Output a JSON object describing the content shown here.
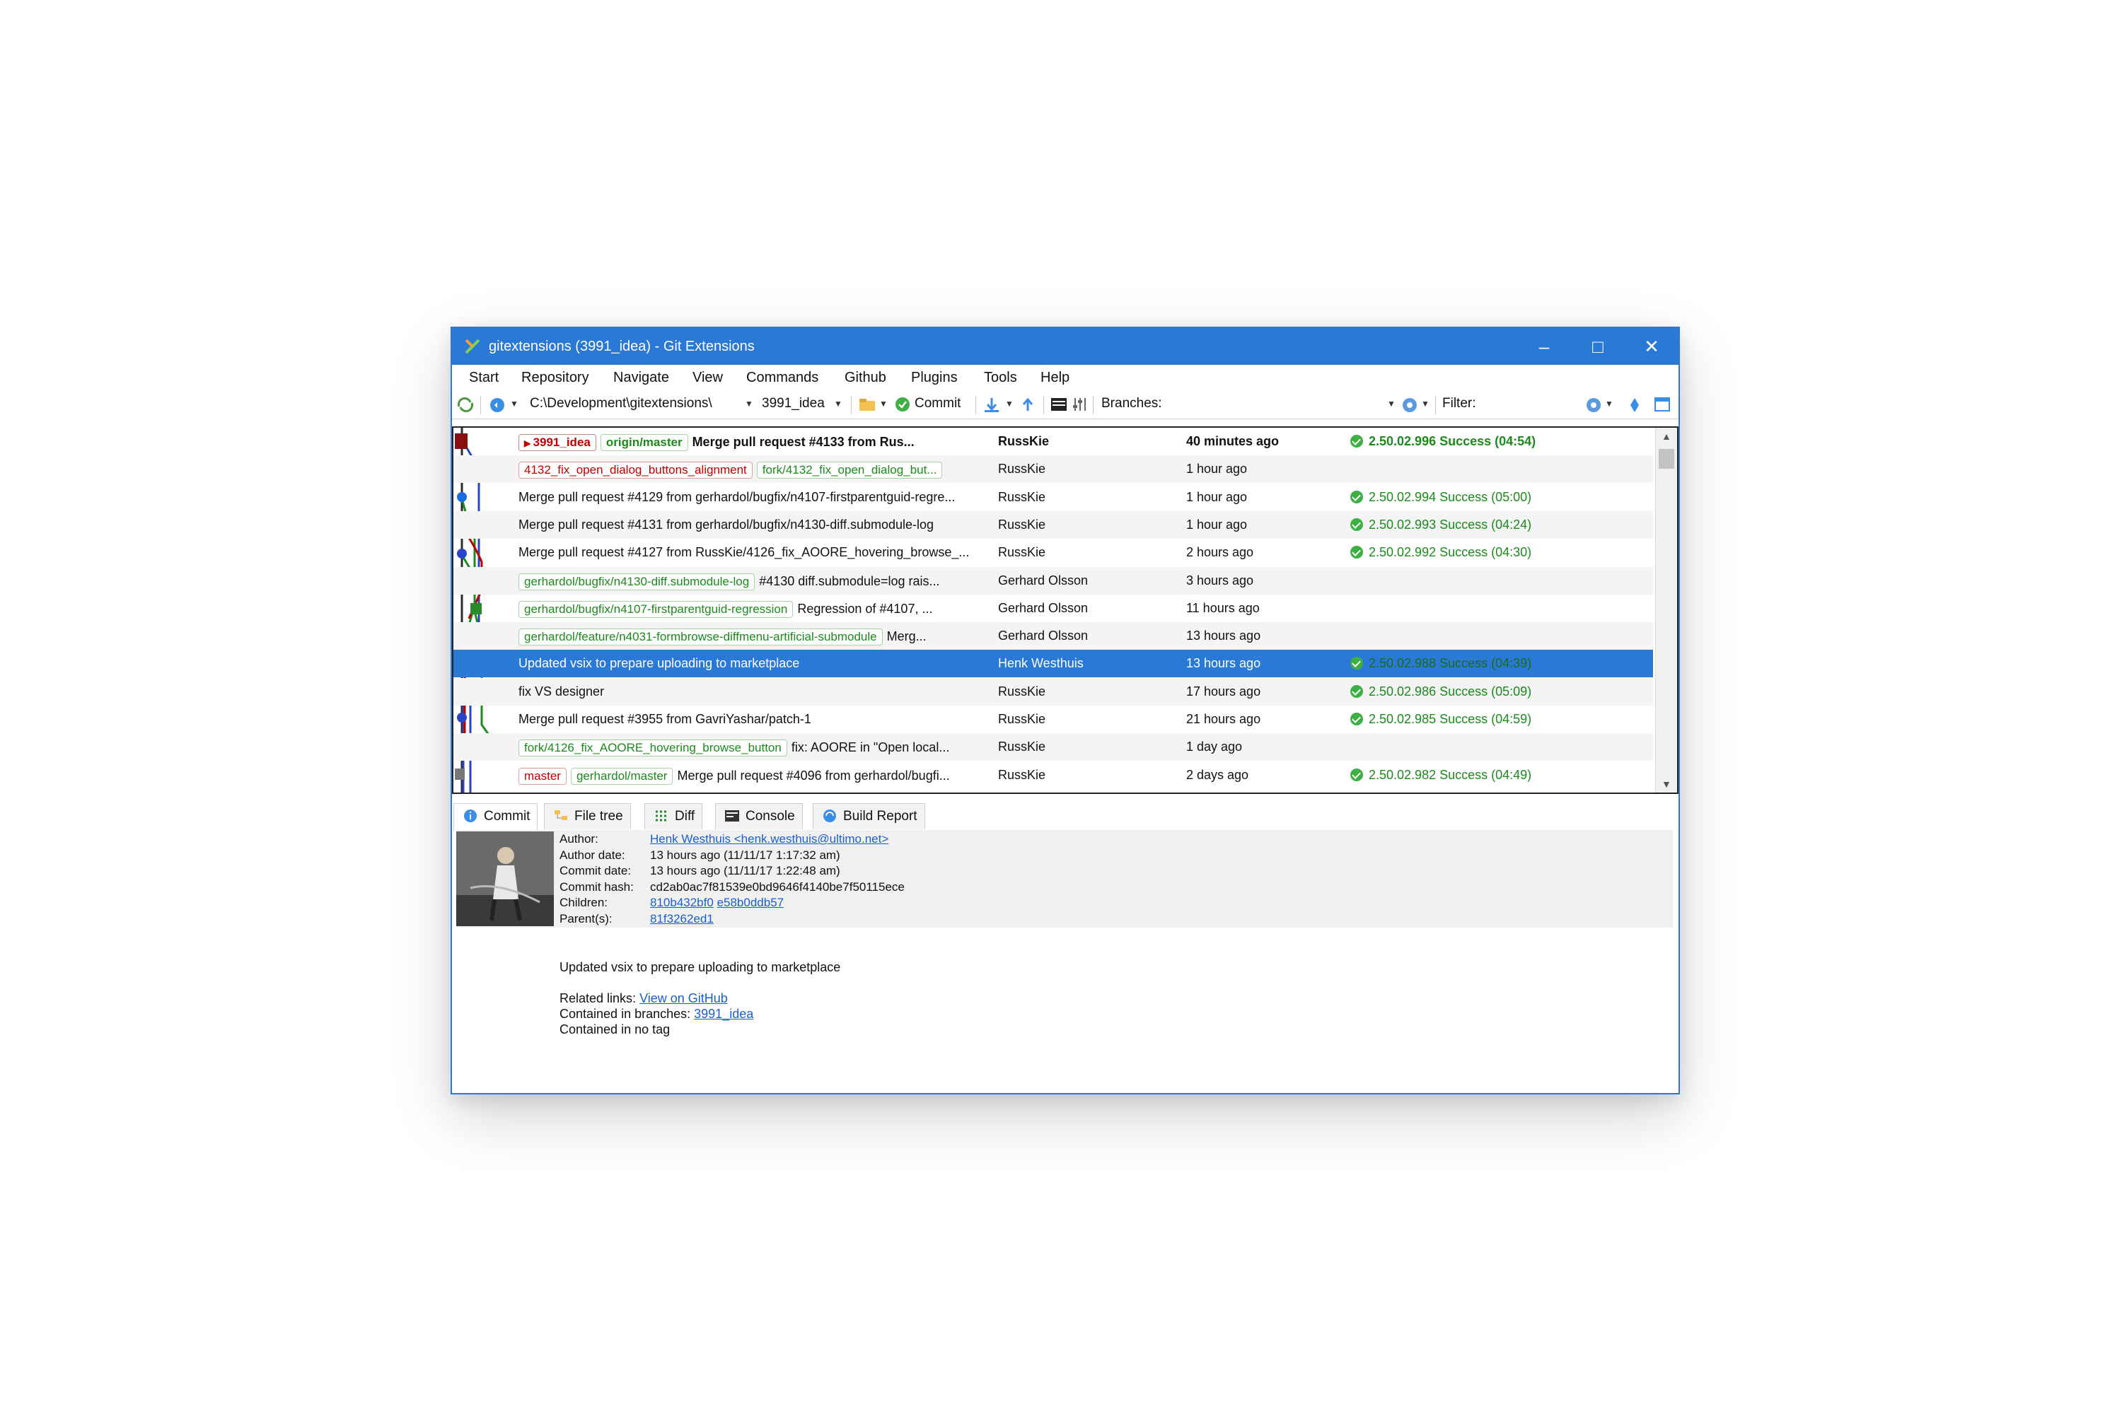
{
  "window": {
    "title": "gitextensions (3991_idea) - Git Extensions"
  },
  "menu": [
    "Start",
    "Repository",
    "Navigate",
    "View",
    "Commands",
    "Github",
    "Plugins",
    "Tools",
    "Help"
  ],
  "toolbar": {
    "path": "C:\\Development\\gitextensions\\",
    "branch": "3991_idea",
    "commit_label": "Commit",
    "branches_label": "Branches:",
    "filter_label": "Filter:"
  },
  "commits": [
    {
      "refs": [
        {
          "text": "3991_idea",
          "kind": "cur"
        },
        {
          "text": "origin/master",
          "kind": "green"
        }
      ],
      "message": "Merge pull request #4133 from Rus...",
      "author": "RussKie",
      "date": "40 minutes ago",
      "build": "2.50.02.996 Success  (04:54)",
      "bold": true
    },
    {
      "refs": [
        {
          "text": "4132_fix_open_dialog_buttons_alignment",
          "kind": "red"
        },
        {
          "text": "fork/4132_fix_open_dialog_but...",
          "kind": "green"
        }
      ],
      "message": "",
      "author": "RussKie",
      "date": "1 hour ago",
      "build": ""
    },
    {
      "refs": [],
      "message": "Merge pull request #4129 from gerhardol/bugfix/n4107-firstparentguid-regre...",
      "author": "RussKie",
      "date": "1 hour ago",
      "build": "2.50.02.994 Success  (05:00)"
    },
    {
      "refs": [],
      "message": "Merge pull request #4131 from gerhardol/bugfix/n4130-diff.submodule-log",
      "author": "RussKie",
      "date": "1 hour ago",
      "build": "2.50.02.993 Success  (04:24)"
    },
    {
      "refs": [],
      "message": "Merge pull request #4127 from RussKie/4126_fix_AOORE_hovering_browse_...",
      "author": "RussKie",
      "date": "2 hours ago",
      "build": "2.50.02.992 Success  (04:30)"
    },
    {
      "refs": [
        {
          "text": "gerhardol/bugfix/n4130-diff.submodule-log",
          "kind": "green"
        }
      ],
      "message": "#4130 diff.submodule=log rais...",
      "author": "Gerhard Olsson",
      "date": "3 hours ago",
      "build": ""
    },
    {
      "refs": [
        {
          "text": "gerhardol/bugfix/n4107-firstparentguid-regression",
          "kind": "green"
        }
      ],
      "message": "Regression of #4107, ...",
      "author": "Gerhard Olsson",
      "date": "11 hours ago",
      "build": ""
    },
    {
      "refs": [
        {
          "text": "gerhardol/feature/n4031-formbrowse-diffmenu-artificial-submodule",
          "kind": "green"
        }
      ],
      "message": "Merg...",
      "author": "Gerhard Olsson",
      "date": "13 hours ago",
      "build": ""
    },
    {
      "refs": [],
      "message": "Updated vsix to prepare uploading to marketplace",
      "author": "Henk Westhuis",
      "date": "13 hours ago",
      "build": "2.50.02.988 Success  (04:39)",
      "selected": true
    },
    {
      "refs": [],
      "message": "fix VS designer",
      "author": "RussKie",
      "date": "17 hours ago",
      "build": "2.50.02.986 Success  (05:09)"
    },
    {
      "refs": [],
      "message": "Merge pull request #3955 from GavriYashar/patch-1",
      "author": "RussKie",
      "date": "21 hours ago",
      "build": "2.50.02.985 Success  (04:59)"
    },
    {
      "refs": [
        {
          "text": "fork/4126_fix_AOORE_hovering_browse_button",
          "kind": "green"
        }
      ],
      "message": "fix: AOORE in \"Open local...",
      "author": "RussKie",
      "date": "1 day ago",
      "build": ""
    },
    {
      "refs": [
        {
          "text": "master",
          "kind": "red"
        },
        {
          "text": "gerhardol/master",
          "kind": "green"
        }
      ],
      "message": "Merge pull request #4096 from gerhardol/bugfi...",
      "author": "RussKie",
      "date": "2 days ago",
      "build": "2.50.02.982 Success  (04:49)"
    }
  ],
  "tabs": [
    "Commit",
    "File tree",
    "Diff",
    "Console",
    "Build Report"
  ],
  "details": {
    "author_label": "Author:",
    "author": "Henk Westhuis <henk.westhuis@ultimo.net>",
    "author_date_label": "Author date:",
    "author_date": "13 hours ago (11/11/17 1:17:32 am)",
    "commit_date_label": "Commit date:",
    "commit_date": "13 hours ago (11/11/17 1:22:48 am)",
    "hash_label": "Commit hash:",
    "hash": "cd2ab0ac7f81539e0bd9646f4140be7f50115ece",
    "children_label": "Children:",
    "child1": "810b432bf0",
    "child2": "e58b0ddb57",
    "parents_label": "Parent(s):",
    "parent": "81f3262ed1",
    "message": "Updated vsix to prepare uploading to marketplace",
    "related_label": "Related links:",
    "related_link": "View on GitHub",
    "contained_label": "Contained in branches:",
    "contained_branch": "3991_idea",
    "tag_text": "Contained in no tag"
  },
  "colors": {
    "accent": "#2b79d6",
    "success": "#3cb043",
    "branch_red": "#c00000",
    "branch_green": "#1c8a1c"
  }
}
